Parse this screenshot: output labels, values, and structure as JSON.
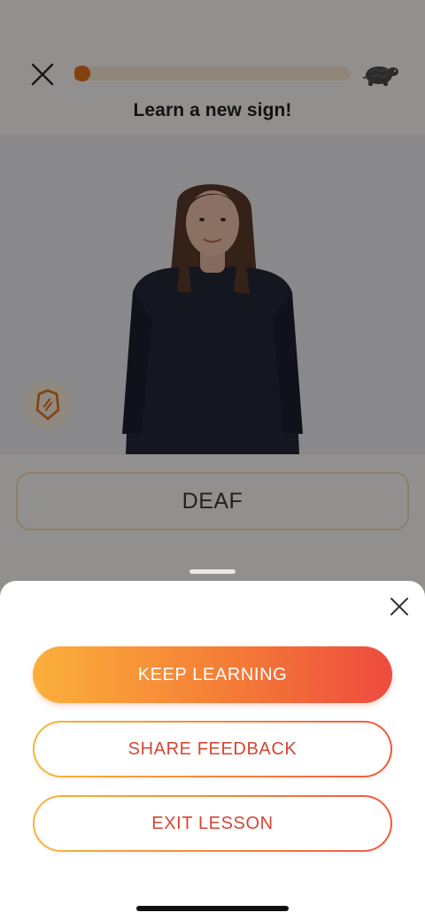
{
  "header": {
    "close_icon": "close-icon",
    "progress": 0.03,
    "speed_icon": "turtle-icon",
    "title": "Learn a new sign!"
  },
  "video": {
    "hint_icon": "hint-icon"
  },
  "answer": {
    "word": "DEAF"
  },
  "sheet": {
    "close_icon": "close-icon",
    "keep_learning_label": "KEEP LEARNING",
    "share_feedback_label": "SHARE FEEDBACK",
    "exit_lesson_label": "EXIT LESSON"
  },
  "colors": {
    "accent_start": "#fbb03b",
    "accent_end": "#ee4b3f",
    "outline_text": "#d64533"
  }
}
